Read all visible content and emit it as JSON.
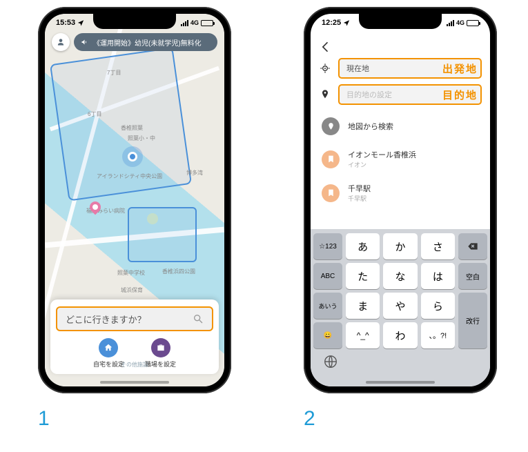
{
  "step_labels": {
    "one": "1",
    "two": "2"
  },
  "phone1": {
    "status": {
      "time": "15:53",
      "network": "4G"
    },
    "announce": "《運用開始》幼児(未就学児)無料化",
    "map_labels": {
      "area1": "7丁目",
      "area2": "6丁目",
      "poi1": "香椎照葉",
      "poi2": "照葉小・中",
      "poi3": "アイランドシティ中央公園",
      "poi4": "福岡みらい病院",
      "poi5": "博多湾",
      "poi6": "照葉中学校",
      "poi7": "香椎浜四公園",
      "poi8": "城浜保育",
      "footer": "その他施設"
    },
    "search_placeholder": "どこに行きますか？",
    "shortcuts": {
      "home": "自宅を設定",
      "work": "職場を設定"
    }
  },
  "phone2": {
    "status": {
      "time": "12:25",
      "network": "4G"
    },
    "fields": {
      "origin_value": "現在地",
      "origin_annot": "出発地",
      "dest_placeholder": "目的地の設定",
      "dest_annot": "目的地"
    },
    "list": {
      "map_search": "地図から検索",
      "item1_title": "イオンモール香椎浜",
      "item1_sub": "イオン",
      "item2_title": "千早駅",
      "item2_sub": "千早駅"
    },
    "keyboard": {
      "rows": [
        [
          "☆123",
          "あ",
          "か",
          "さ",
          "⌫"
        ],
        [
          "ABC",
          "た",
          "な",
          "は",
          "空白"
        ],
        [
          "あいう",
          "ま",
          "や",
          "ら",
          "改行"
        ],
        [
          "😀",
          "^_^",
          "わ",
          "、。?!",
          ""
        ]
      ]
    }
  }
}
